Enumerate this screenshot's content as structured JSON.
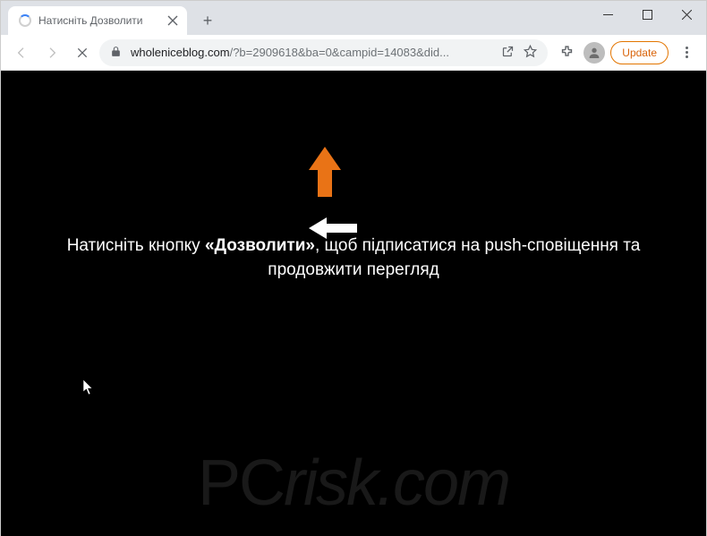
{
  "window": {
    "tab_title": "Натисніть Дозволити"
  },
  "toolbar": {
    "url_host": "wholeniceblog.com",
    "url_rest": "/?b=2909618&ba=0&campid=14083&did...",
    "update_label": "Update"
  },
  "content": {
    "line1_pre": "Натисніть кнопку ",
    "line1_bold": "«Дозволити»",
    "line1_post": ", щоб підписатися на push-сповіщення та",
    "line2": "продовжити перегляд"
  },
  "watermark": {
    "text_pc": "PC",
    "text_rest": "risk.com"
  }
}
